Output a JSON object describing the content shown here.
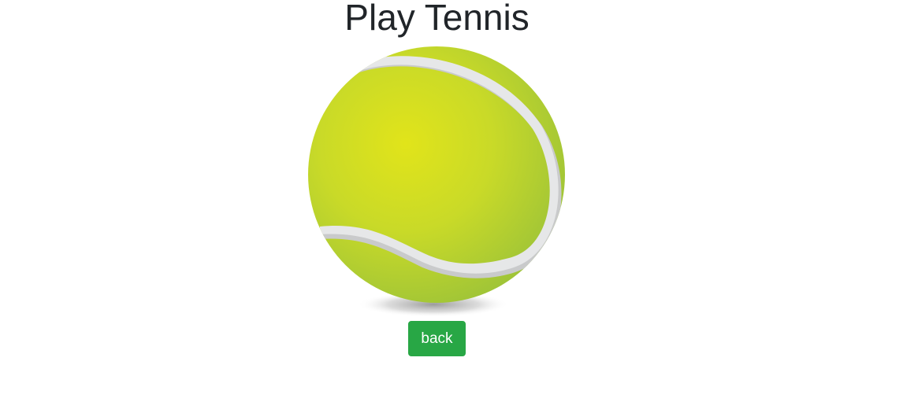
{
  "page": {
    "title": "Play Tennis"
  },
  "image": {
    "subject": "tennis-ball",
    "colors": {
      "felt_light": "#e1e41a",
      "felt_mid": "#c5d92a",
      "felt_dark": "#98c13a",
      "seam": "#e6e7e8",
      "seam_shadow": "#c9cacb",
      "shadow": "#8a8a8a"
    }
  },
  "actions": {
    "back_label": "back",
    "back_color": "#28a745"
  }
}
